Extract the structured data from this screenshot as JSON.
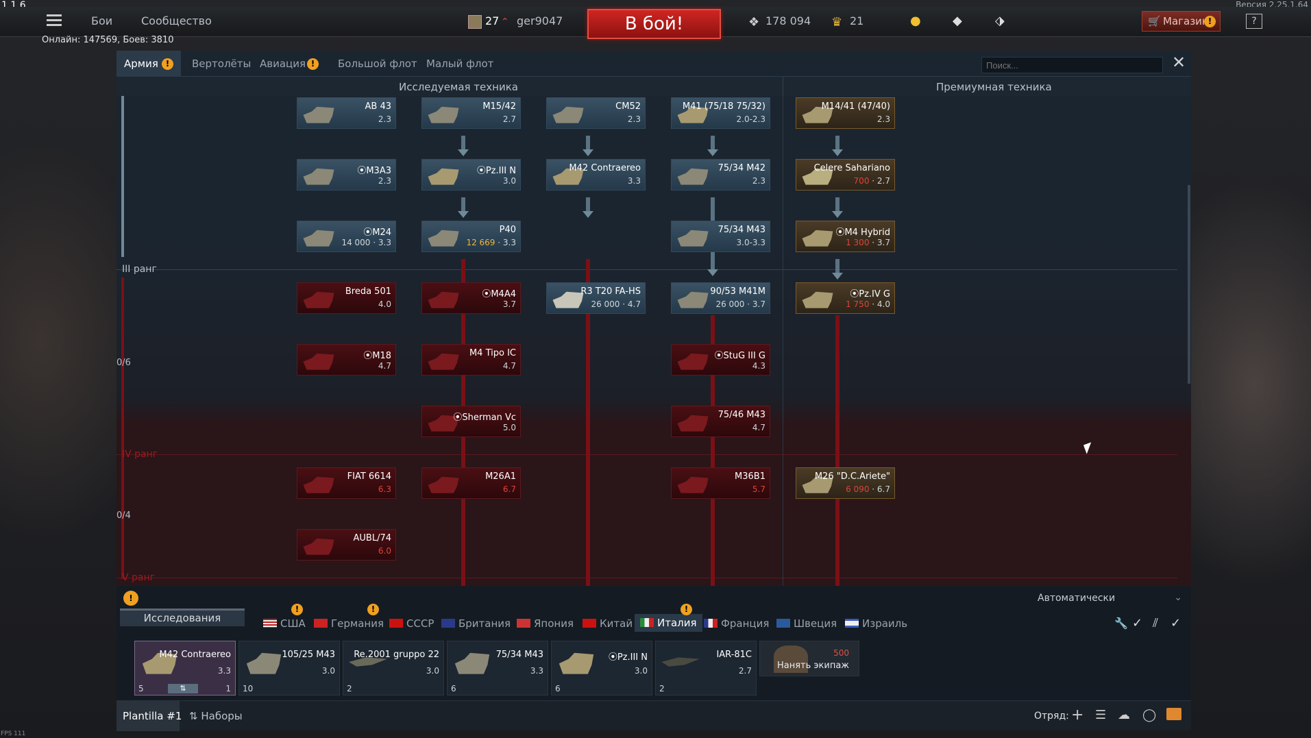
{
  "fps_top": "1 1 6",
  "version": "Версия 2.25.1.64",
  "topbar": {
    "battles": "Бои",
    "community": "Сообщество",
    "level": "27",
    "username": "ger9047",
    "fight": "В бой!",
    "silver": "178 094",
    "gold": "21",
    "shop": "Магазин",
    "help": "?"
  },
  "online": "Онлайн: 147569, Боев: 3810",
  "tabs": [
    {
      "label": "Армия",
      "warn": true
    },
    {
      "label": "Вертолёты",
      "warn": false
    },
    {
      "label": "Авиация",
      "warn": true
    },
    {
      "label": "Большой флот",
      "warn": false
    },
    {
      "label": "Малый флот",
      "warn": false
    }
  ],
  "search_placeholder": "Поиск...",
  "headers": {
    "researchable": "Исследуемая техника",
    "premium": "Премиумная техника"
  },
  "ranks": {
    "rank3": "III ранг",
    "rank4": "IV ранг",
    "rank5": "V ранг",
    "progress4": "0/6",
    "progress5": "0/4"
  },
  "cards": [
    {
      "name": "AB 43",
      "br": "2.3"
    },
    {
      "name": "M15/42",
      "br": "2.7"
    },
    {
      "name": "CM52",
      "br": "2.3"
    },
    {
      "name": "M41 (75/18 75/32)",
      "br": "2.0-2.3"
    },
    {
      "name": "⦿M3A3",
      "br": "2.3"
    },
    {
      "name": "⦿Pz.III N",
      "br": "3.0"
    },
    {
      "name": "M42 Contraereo",
      "br": "3.3"
    },
    {
      "name": "75/34 M42",
      "br": "2.3"
    },
    {
      "name": "⦿M24",
      "cost": "14 000",
      "br": "3.3"
    },
    {
      "name": "P40",
      "cost": "12 669",
      "br": "3.3"
    },
    {
      "name": "75/34 M43",
      "br": "3.0-3.3"
    },
    {
      "name": "Breda 501",
      "br": "4.0"
    },
    {
      "name": "⦿M4A4",
      "br": "3.7"
    },
    {
      "name": "R3 T20 FA-HS",
      "cost": "26 000",
      "br": "4.7"
    },
    {
      "name": "90/53 M41M",
      "cost": "26 000",
      "br": "3.7"
    },
    {
      "name": "⦿M18",
      "br": "4.7"
    },
    {
      "name": "M4 Tipo IC",
      "br": "4.7"
    },
    {
      "name": "⦿StuG III G",
      "br": "4.3"
    },
    {
      "name": "⦿Sherman Vc",
      "br": "5.0"
    },
    {
      "name": "75/46 M43",
      "br": "4.7"
    },
    {
      "name": "FIAT 6614",
      "br": "6.3"
    },
    {
      "name": "M26A1",
      "br": "6.7"
    },
    {
      "name": "M36B1",
      "br": "5.7"
    },
    {
      "name": "AUBL/74",
      "br": "6.0"
    }
  ],
  "premium": [
    {
      "name": "M14/41 (47/40)",
      "br": "2.3"
    },
    {
      "name": "Celere Sahariano",
      "cost": "700",
      "br": "2.7"
    },
    {
      "name": "⦿M4 Hybrid",
      "cost": "1 300",
      "br": "3.7"
    },
    {
      "name": "⦿Pz.IV G",
      "cost": "1 750",
      "br": "4.0"
    },
    {
      "name": "M26 \"D.C.Ariete\"",
      "cost": "6 090",
      "br": "6.7"
    }
  ],
  "research_label": "Исследования",
  "auto": "Автоматически",
  "nations": [
    "США",
    "Германия",
    "СССР",
    "Британия",
    "Япония",
    "Китай",
    "Италия",
    "Франция",
    "Швеция",
    "Израиль"
  ],
  "crew": [
    {
      "name": "M42 Contraereo",
      "br": "3.3",
      "count": "5",
      "extra": "1"
    },
    {
      "name": "105/25 M43",
      "br": "3.0",
      "count": "10"
    },
    {
      "name": "Re.2001 gruppo 22",
      "br": "3.0",
      "count": "2"
    },
    {
      "name": "75/34 M43",
      "br": "3.3",
      "count": "6"
    },
    {
      "name": "⦿Pz.III N",
      "br": "3.0",
      "count": "6"
    },
    {
      "name": "IAR-81C",
      "br": "2.7",
      "count": "2"
    }
  ],
  "hire": {
    "cost": "500",
    "label": "Нанять экипаж"
  },
  "footer": {
    "preset": "Plantilla #1",
    "sets": "Наборы",
    "squad": "Отряд:"
  },
  "fps_bottom": "FPS 111"
}
